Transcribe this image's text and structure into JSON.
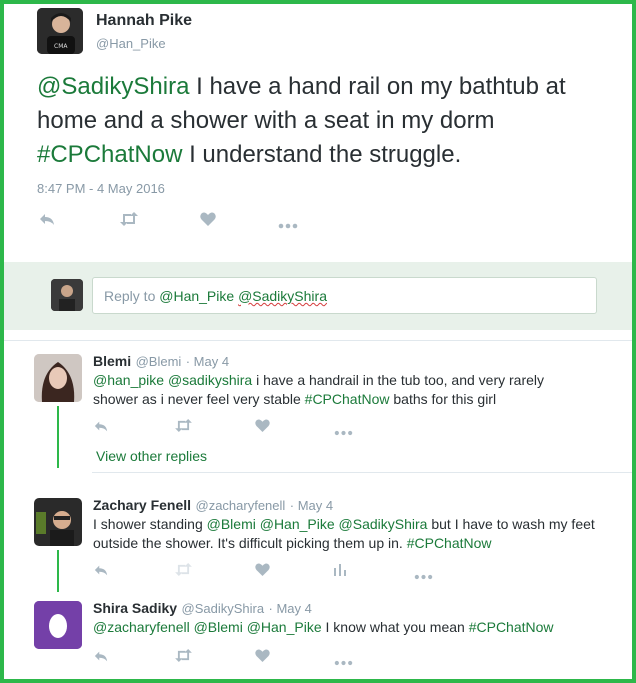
{
  "main_tweet": {
    "name": "Hannah Pike",
    "handle": "@Han_Pike",
    "text_parts": {
      "mention": "@SadikyShira",
      "text1": " I have a hand rail on my bathtub at home and a shower with a seat in my dorm ",
      "hashtag": "#CPChatNow",
      "text2": " I understand the struggle."
    },
    "timestamp": "8:47 PM - 4 May 2016",
    "actions": [
      "reply-icon",
      "retweet-icon",
      "like-icon",
      "more-icon"
    ]
  },
  "reply_composer": {
    "prefix": "Reply to ",
    "mention1": "@Han_Pike",
    "mention2": "@SadikyShira"
  },
  "replies": [
    {
      "name": "Blemi",
      "handle": "@Blemi",
      "date": "· May 4",
      "m1": "@han_pike",
      "m2": "@sadikyshira",
      "t1": " i have a handrail in the tub too, and very rarely shower as i never feel very stable ",
      "tag": "#CPChatNow",
      "t2": " baths for this girl"
    },
    {
      "name": "Zachary Fenell",
      "handle": "@zacharyfenell",
      "date": "· May 4",
      "t0": "I shower standing ",
      "m1": "@Blemi",
      "m2": "@Han_Pike",
      "m3": "@SadikyShira",
      "t1": " but I have to wash my feet outside the shower. It's difficult picking them up in. ",
      "tag": "#CPChatNow"
    },
    {
      "name": "Shira Sadiky",
      "handle": "@SadikyShira",
      "date": "· May 4",
      "m1": "@zacharyfenell",
      "m2": "@Blemi",
      "m3": "@Han_Pike",
      "t1": " I know what you mean ",
      "tag": "#CPChatNow"
    }
  ],
  "view_other_replies": "View other replies",
  "colors": {
    "border": "#2db84a",
    "link": "#1b7a3a",
    "reply_bar": "#e8f1ea",
    "icon": "#aab8c2",
    "egg_bg": "#7440a8"
  }
}
